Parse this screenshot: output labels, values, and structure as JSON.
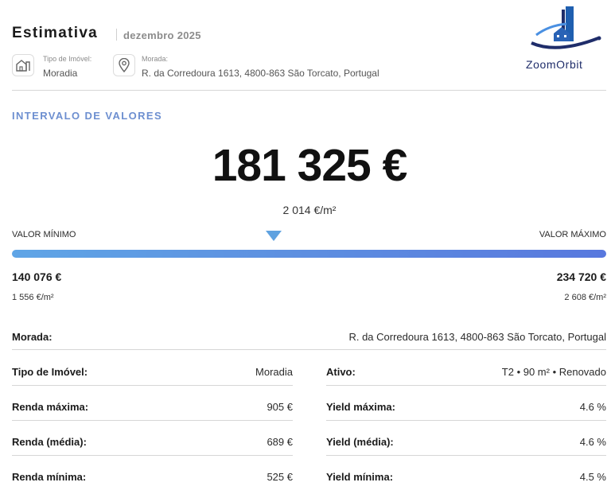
{
  "header": {
    "title": "Estimativa",
    "date": "dezembro 2025",
    "property_type_label": "Tipo de Imóvel:",
    "property_type_value": "Moradia",
    "address_label": "Morada:",
    "address_value": "R. da Corredoura 1613, 4800-863 São Torcato, Portugal",
    "logo_text": "ZoomOrbit"
  },
  "range": {
    "section_title": "INTERVALO DE VALORES",
    "price": "181 325 €",
    "price_per_sqm": "2 014 €/m²",
    "min_label": "VALOR MÍNIMO",
    "max_label": "VALOR MÁXIMO",
    "min_value": "140 076 €",
    "max_value": "234 720 €",
    "min_sqm": "1 556 €/m²",
    "max_sqm": "2 608 €/m²",
    "marker_fraction": 0.44,
    "bar_color_start": "#5fa5e6",
    "bar_color_end": "#5878de"
  },
  "details": {
    "morada_label": "Morada:",
    "morada_value": "R. da Corredoura 1613, 4800-863 São Torcato, Portugal",
    "left": [
      {
        "label": "Tipo de Imóvel:",
        "value": "Moradia"
      },
      {
        "label": "Renda máxima:",
        "value": "905 €"
      },
      {
        "label": "Renda (média):",
        "value": "689 €"
      },
      {
        "label": "Renda mínima:",
        "value": "525 €"
      }
    ],
    "right": [
      {
        "label": "Ativo:",
        "value": "T2 • 90 m² • Renovado"
      },
      {
        "label": "Yield máxima:",
        "value": "4.6 %"
      },
      {
        "label": "Yield (média):",
        "value": "4.6 %"
      },
      {
        "label": "Yield mínima:",
        "value": "4.5 %"
      }
    ]
  },
  "colors": {
    "accent": "#6d8fd0",
    "logo_blue": "#1f2d6a"
  }
}
